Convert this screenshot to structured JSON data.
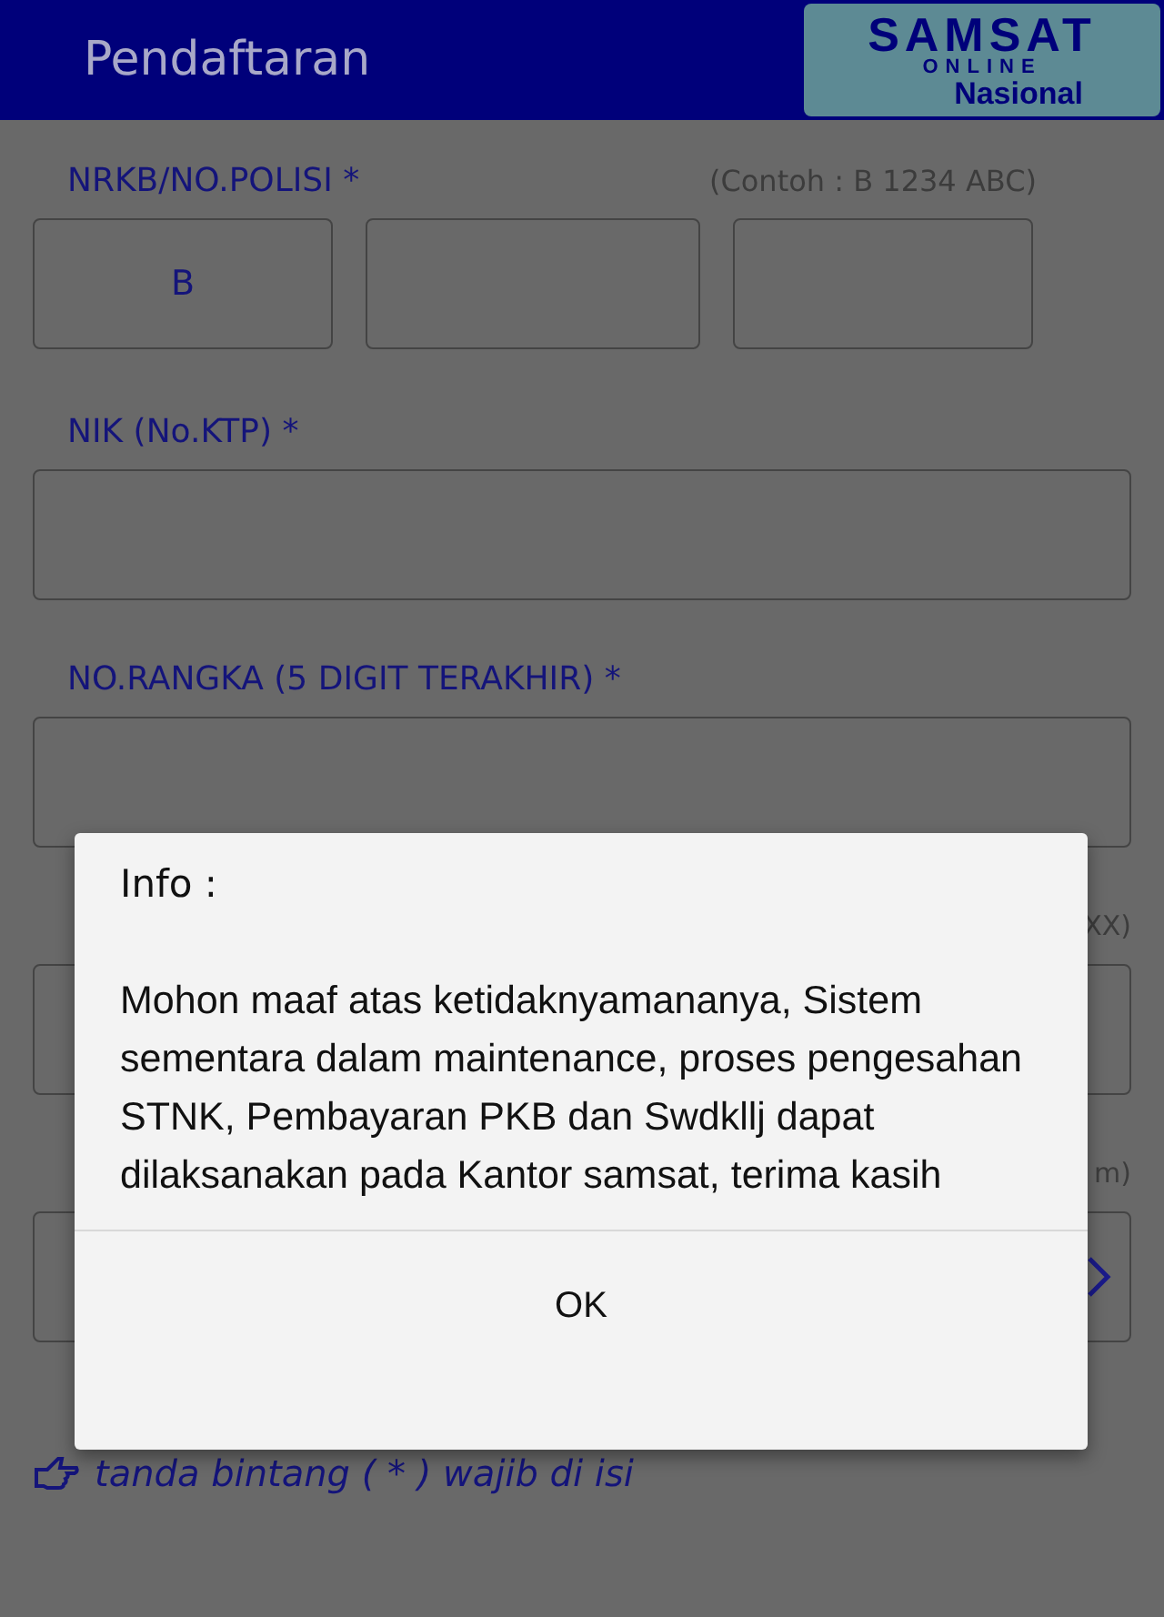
{
  "header": {
    "title": "Pendaftaran",
    "logo": {
      "line_1": "SAMSAT",
      "line_2": "ONLINE",
      "line_3": "Nasional"
    }
  },
  "plate": {
    "label": "NRKB/NO.POLISI *",
    "hint": "(Contoh : B 1234 ABC)",
    "value": "B"
  },
  "fields": [
    {
      "label": "NIK (No.KTP) *"
    },
    {
      "label": "NO.RANGKA (5 DIGIT TERAKHIR) *"
    },
    {
      "hint": "XX)"
    },
    {
      "hint": "m)",
      "kind": "select"
    }
  ],
  "dialog": {
    "title": "Info  :",
    "message": "Mohon maaf atas ketidaknyamananya, Sistem sementara dalam maintenance, proses pengesahan STNK, Pembayaran PKB dan Swdkllj dapat dilaksanakan pada Kantor samsat, terima kasih",
    "button": "OK"
  },
  "note": "tanda bintang ( * ) wajib di isi"
}
